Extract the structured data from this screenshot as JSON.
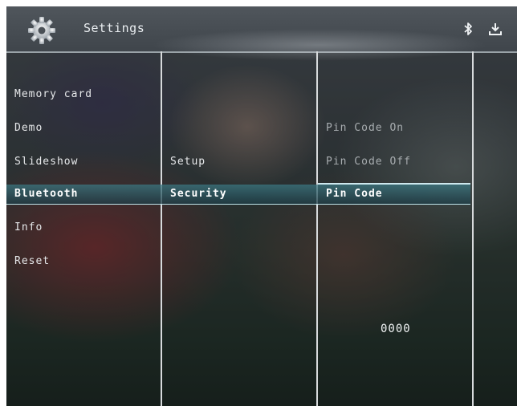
{
  "header": {
    "title": "Settings",
    "icons": [
      "gear-icon",
      "bluetooth-icon",
      "download-icon"
    ]
  },
  "menu": {
    "column1": [
      "Memory card",
      "Demo",
      "Slideshow",
      "Bluetooth",
      "Info",
      "Reset"
    ],
    "column2": [
      "Setup",
      "Security"
    ],
    "column3": [
      "Pin Code On",
      "Pin Code Off",
      "Pin Code"
    ],
    "selected": {
      "column1": "Bluetooth",
      "column2": "Security",
      "column3": "Pin Code"
    }
  },
  "pin": {
    "value": "0000"
  },
  "colors": {
    "highlight": "#2f7f8a",
    "divider": "#d7dadc",
    "text": "#e6e8ea"
  }
}
